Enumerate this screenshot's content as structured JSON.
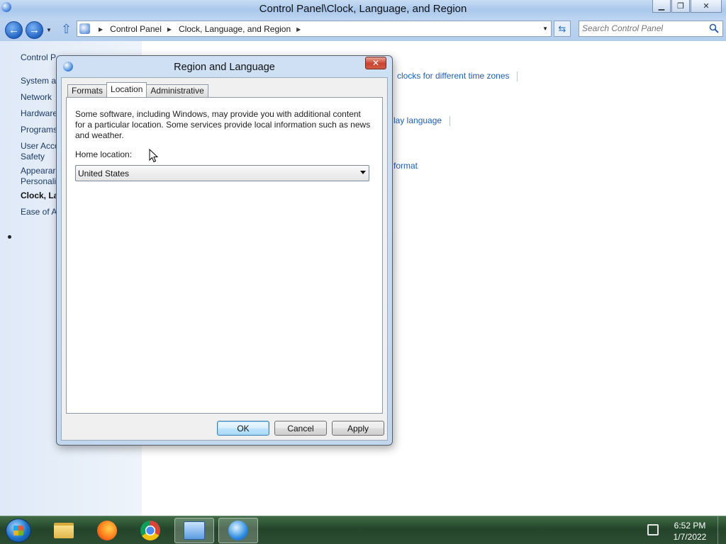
{
  "window": {
    "title": "Control Panel\\Clock, Language, and Region",
    "minimize_label": "▭",
    "restore_label": "❐",
    "close_label": "✕"
  },
  "navbar": {
    "breadcrumbs": [
      "Control Panel",
      "Clock, Language, and Region"
    ],
    "search_placeholder": "Search Control Panel"
  },
  "leftpane": {
    "items": [
      "Control P",
      "System a",
      "Network",
      "Hardware",
      "Programs",
      "User Acco",
      "Safety",
      "Appearar",
      "Personali",
      "Clock, La",
      "Ease of A"
    ]
  },
  "content": {
    "links": [
      "clocks for different time zones",
      "lay language",
      "format"
    ]
  },
  "dialog": {
    "title": "Region and Language",
    "close_label": "✕",
    "tabs": [
      "Formats",
      "Location",
      "Administrative"
    ],
    "active_tab": "Location",
    "description": "Some software, including Windows, may provide you with additional content for a particular location. Some services provide local information such as news and weather.",
    "home_location_label": "Home location:",
    "home_location_value": "United States",
    "buttons": {
      "ok": "OK",
      "cancel": "Cancel",
      "apply": "Apply"
    }
  },
  "taskbar": {
    "apps": [
      "windows-explorer",
      "firefox",
      "chrome",
      "control-panel",
      "region-and-language"
    ],
    "time": "6:52 PM",
    "date": "1/7/2022"
  }
}
